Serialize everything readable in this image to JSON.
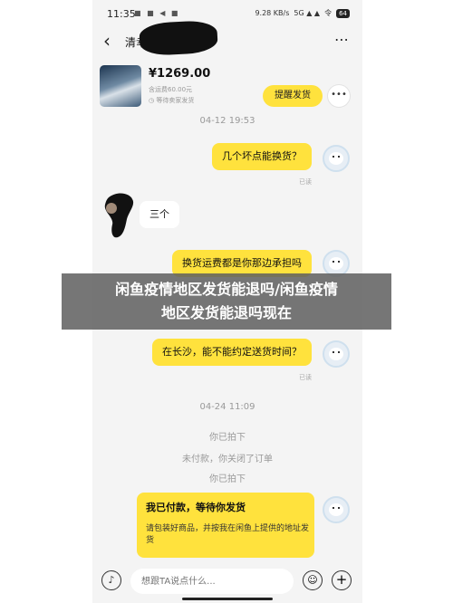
{
  "status_bar": {
    "time": "11:35",
    "app_icons": "■ ■ ◀ ■",
    "network_speed": "9.28 KB/s",
    "signal": "5G ▲ ▲",
    "wifi": "令",
    "battery": "64"
  },
  "header": {
    "title": "清幸",
    "more_icon": "⋯"
  },
  "product": {
    "price": "¥1269.00",
    "shipping": "含运费60.00元",
    "status": "◷ 等待卖家发货",
    "remind_button": "提醒发货",
    "more_button": "•••"
  },
  "messages": {
    "time_1": "04-12 19:53",
    "msg_1": "几个坏点能换货？",
    "read_1": "已读",
    "reply_1": "三个",
    "msg_2": "换货运费都是你那边承担吗",
    "msg_3": "在长沙，能不能约定送货时间？",
    "read_3": "已读",
    "time_2": "04-24 11:09",
    "sys_1": "你已拍下",
    "sys_2": "未付款，你关闭了订单",
    "sys_3": "你已拍下",
    "card_title": "我已付款，等待你发货",
    "card_body": "请包装好商品，并按我在闲鱼上提供的地址发货"
  },
  "input_bar": {
    "placeholder": "想跟TA说点什么..."
  },
  "overlay": {
    "line_1": "闲鱼疫情地区发货能退吗/闲鱼疫情",
    "line_2": "地区发货能退吗现在"
  },
  "colors": {
    "accent": "#ffe23d",
    "chat_bg": "#f4f4f4"
  }
}
